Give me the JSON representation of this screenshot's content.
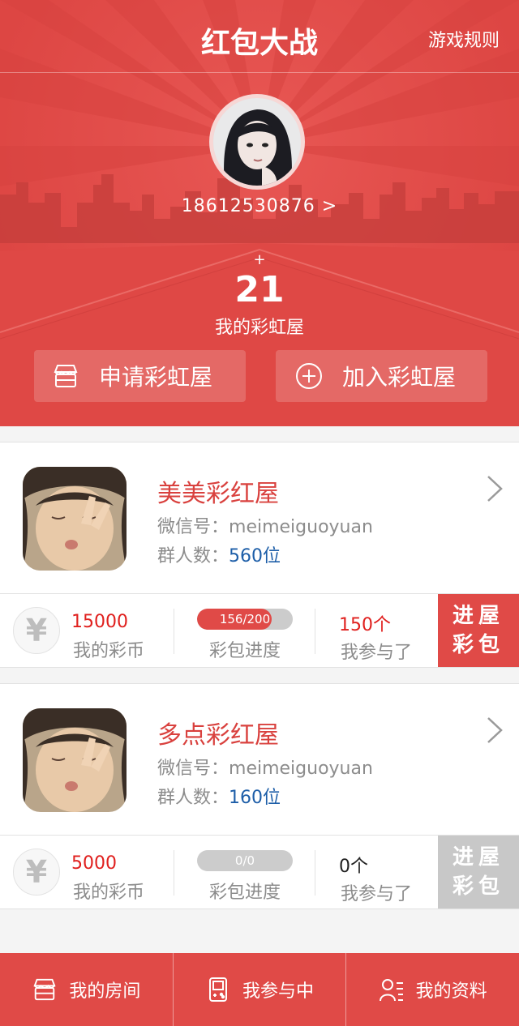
{
  "header": {
    "title": "红包大战",
    "rules_link": "游戏规则",
    "phone": "18612530876 >",
    "plus": "+",
    "rainbow_count": "21",
    "rainbow_label": "我的彩虹屋",
    "apply_button": "申请彩虹屋",
    "join_button": "加入彩虹屋"
  },
  "colors": {
    "brand_red": "#e04a47",
    "enter_active": "#e04a47",
    "enter_disabled": "#c8c8c8",
    "member_blue": "#1d5ea8"
  },
  "rooms": [
    {
      "name": "美美彩红屋",
      "wechat_label": "微信号：",
      "wechat_id": "meimeiguoyuan",
      "members_label": "群人数：",
      "members": "560位",
      "coin_icon": "¥",
      "coins": "15000",
      "coins_label": "我的彩币",
      "progress_text": "156/200",
      "progress_fraction": 0.78,
      "progress_label": "彩包进度",
      "joined": "150个",
      "joined_label": "我参与了",
      "enter_line1": "进屋",
      "enter_line2": "彩包",
      "enter_enabled": true
    },
    {
      "name": "多点彩红屋",
      "wechat_label": "微信号：",
      "wechat_id": "meimeiguoyuan",
      "members_label": "群人数：",
      "members": "160位",
      "coin_icon": "¥",
      "coins": "5000",
      "coins_label": "我的彩币",
      "progress_text": "0/0",
      "progress_fraction": 0,
      "progress_label": "彩包进度",
      "joined": "0个",
      "joined_label": "我参与了",
      "enter_line1": "进屋",
      "enter_line2": "彩包",
      "enter_enabled": false
    }
  ],
  "tabs": [
    {
      "label": "我的房间",
      "icon": "room-icon"
    },
    {
      "label": "我参与中",
      "icon": "gameboy-icon"
    },
    {
      "label": "我的资料",
      "icon": "profile-icon"
    }
  ]
}
